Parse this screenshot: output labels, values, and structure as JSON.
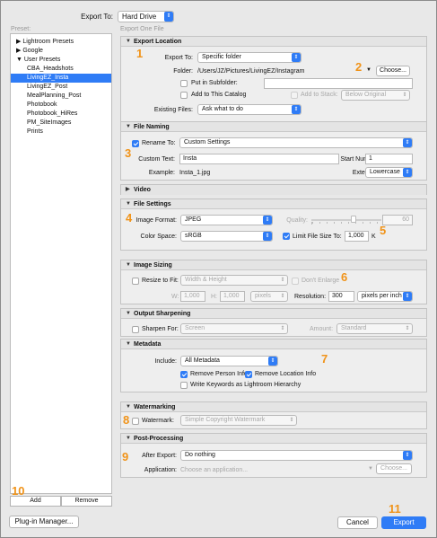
{
  "header": {
    "export_to_label": "Export To:",
    "export_to_value": "Hard Drive"
  },
  "left": {
    "preset_label": "Preset:",
    "presets": [
      {
        "label": "▶ Lightroom Presets"
      },
      {
        "label": "▶ Google"
      },
      {
        "label": "▼ User Presets"
      },
      {
        "label": "CBA_Headshots"
      },
      {
        "label": "LivingEZ_Insta"
      },
      {
        "label": "LivingEZ_Post"
      },
      {
        "label": "MealPlanning_Post"
      },
      {
        "label": "Photobook"
      },
      {
        "label": "Photobook_HiRes"
      },
      {
        "label": "PM_SiteImages"
      },
      {
        "label": "Prints"
      }
    ],
    "selected_index": 4,
    "add_label": "Add",
    "remove_label": "Remove"
  },
  "right": {
    "export_count": "Export One File"
  },
  "location": {
    "title": "Export Location",
    "export_to_label": "Export To:",
    "export_to_value": "Specific folder",
    "folder_label": "Folder:",
    "folder_path": "/Users/JZ/Pictures/LivingEZ/Instagram",
    "choose_label": "Choose...",
    "subfolder_label": "Put in Subfolder:",
    "catalog_label": "Add to This Catalog",
    "stack_label": "Add to Stack:",
    "stack_value": "Below Original",
    "existing_label": "Existing Files:",
    "existing_value": "Ask what to do"
  },
  "naming": {
    "title": "File Naming",
    "rename_label": "Rename To:",
    "rename_value": "Custom Settings",
    "custom_label": "Custom Text:",
    "custom_value": "Insta",
    "start_label": "Start Number:",
    "start_value": "1",
    "example_label": "Example:",
    "example_value": "Insta_1.jpg",
    "ext_label": "Extensions:",
    "ext_value": "Lowercase"
  },
  "video": {
    "title": "Video"
  },
  "file_settings": {
    "title": "File Settings",
    "format_label": "Image Format:",
    "format_value": "JPEG",
    "quality_label": "Quality:",
    "quality_value": "60",
    "quality_fraction": 0.6,
    "color_label": "Color Space:",
    "color_value": "sRGB",
    "limit_label": "Limit File Size To:",
    "limit_value": "1,000",
    "limit_unit": "K"
  },
  "sizing": {
    "title": "Image Sizing",
    "resize_label": "Resize to Fit:",
    "resize_value": "Width & Height",
    "enlarge_label": "Don't Enlarge",
    "w_label": "W:",
    "w_value": "1,000",
    "h_label": "H:",
    "h_value": "1,000",
    "unit_value": "pixels",
    "resolution_label": "Resolution:",
    "resolution_value": "300",
    "resolution_unit": "pixels per inch"
  },
  "sharpening": {
    "title": "Output Sharpening",
    "sharpen_label": "Sharpen For:",
    "sharpen_value": "Screen",
    "amount_label": "Amount:",
    "amount_value": "Standard"
  },
  "metadata": {
    "title": "Metadata",
    "include_label": "Include:",
    "include_value": "All Metadata",
    "person_label": "Remove Person Info",
    "location_label": "Remove Location Info",
    "keywords_label": "Write Keywords as Lightroom Hierarchy"
  },
  "watermark": {
    "title": "Watermarking",
    "label": "Watermark:",
    "value": "Simple Copyright Watermark"
  },
  "post": {
    "title": "Post-Processing",
    "after_label": "After Export:",
    "after_value": "Do nothing",
    "app_label": "Application:",
    "app_placeholder": "Choose an application...",
    "choose_label": "Choose..."
  },
  "footer": {
    "plugin_label": "Plug-in Manager...",
    "cancel_label": "Cancel",
    "export_label": "Export"
  },
  "callouts": [
    "1",
    "2",
    "3",
    "4",
    "5",
    "6",
    "7",
    "8",
    "9",
    "10",
    "11"
  ],
  "colors": {
    "accent": "#2f7cf6",
    "callout": "#f09319"
  },
  "icons": {
    "popup_arrow": "chevron-updown-icon",
    "section_toggle": "disclosure-triangle-icon",
    "check": "checkmark-icon"
  }
}
